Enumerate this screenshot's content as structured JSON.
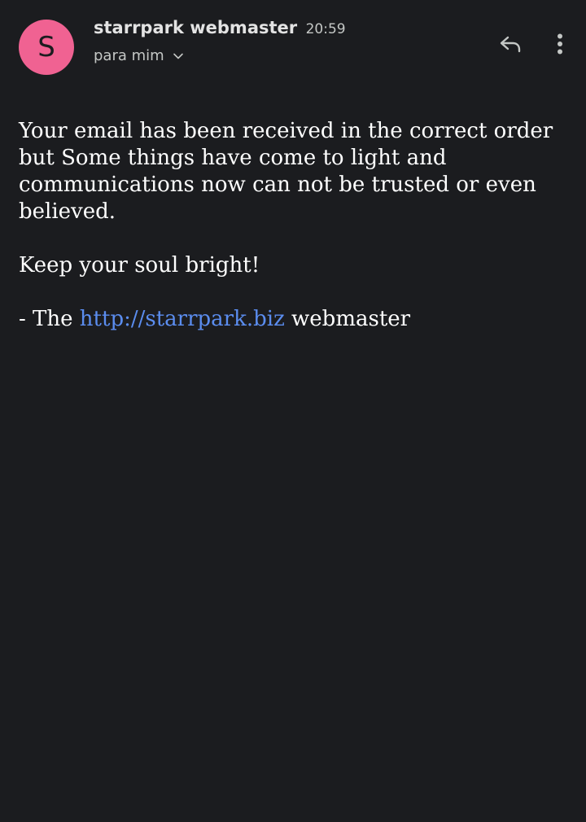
{
  "header": {
    "avatar_letter": "S",
    "sender_name": "starrpark webmaster",
    "time": "20:59",
    "recipient": "para mim",
    "reply_icon": "reply-icon",
    "more_icon": "more-vert-icon",
    "chevron_icon": "chevron-down-icon"
  },
  "message": {
    "paragraph1": "Your email has been received in the correct order but Some things have come to light and communications now can not be trusted or even believed.",
    "paragraph2": "Keep your soul bright!",
    "signature_prefix": "- The ",
    "signature_link": "http://starrpark.biz",
    "signature_suffix": " webmaster"
  },
  "colors": {
    "background": "#1b1c1f",
    "avatar": "#f06292",
    "link": "#5b8def",
    "text": "#ffffff",
    "secondary_text": "#c4c7c5"
  }
}
